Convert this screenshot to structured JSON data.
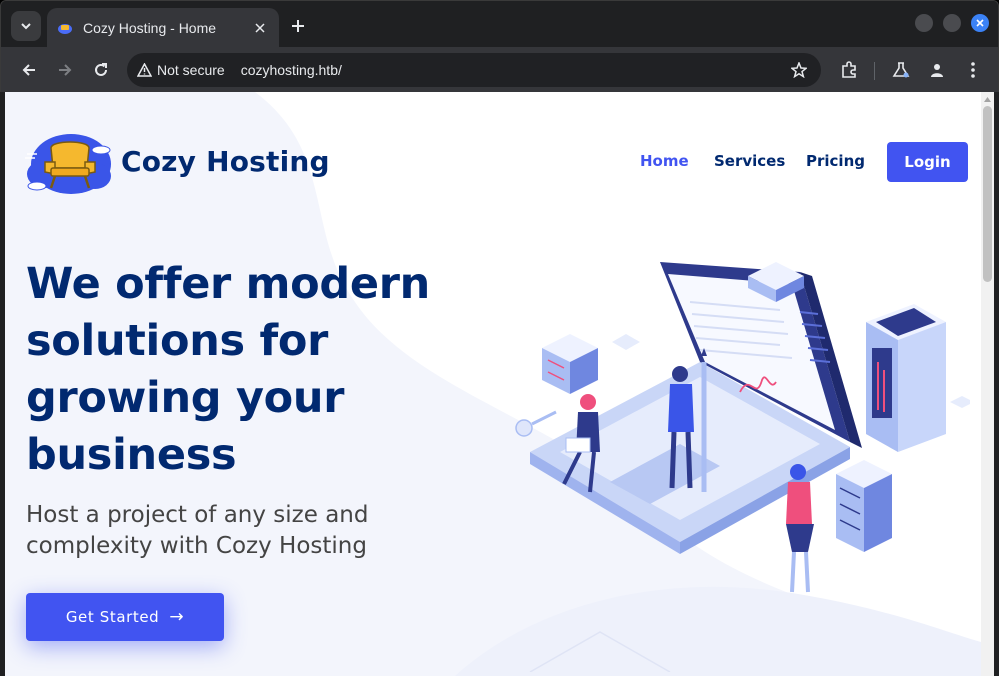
{
  "browser": {
    "tab_title": "Cozy Hosting - Home",
    "security_label": "Not secure",
    "url": "cozyhosting.htb/"
  },
  "site": {
    "brand_name": "Cozy Hosting",
    "nav": {
      "home": "Home",
      "services": "Services",
      "pricing": "Pricing",
      "login": "Login"
    },
    "hero": {
      "title_lines": [
        "We offer modern",
        "solutions for",
        "growing your",
        "business"
      ],
      "subtitle_lines": [
        "Host a project of any size and",
        "complexity with Cozy Hosting"
      ],
      "cta_label": "Get Started",
      "cta_arrow": "→"
    }
  },
  "colors": {
    "primary": "#4154f1",
    "navy": "#012970",
    "text_gray": "#444444"
  },
  "icons": [
    "tab-search-icon",
    "favicon-icon",
    "close-icon",
    "plus-icon",
    "back-icon",
    "forward-icon",
    "reload-icon",
    "warning-icon",
    "star-icon",
    "extensions-icon",
    "labs-icon",
    "profile-icon",
    "menu-icon",
    "arrow-right-icon"
  ]
}
